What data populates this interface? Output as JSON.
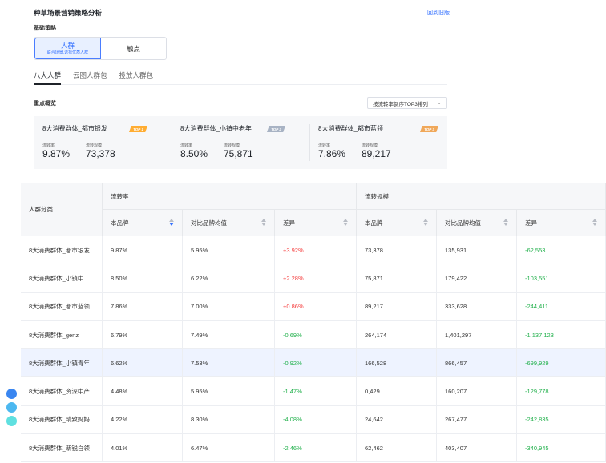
{
  "header": {
    "title": "种草场景营销策略分析",
    "back_label": "回到旧版"
  },
  "strategy": {
    "label": "基础策略",
    "options": [
      {
        "label": "人群",
        "sub": "联合场景,选择优质人群",
        "active": true
      },
      {
        "label": "触点",
        "active": false
      }
    ]
  },
  "tabs": [
    {
      "label": "八大人群",
      "active": true
    },
    {
      "label": "云图人群包",
      "active": false
    },
    {
      "label": "投放人群包",
      "active": false
    }
  ],
  "overview": {
    "label": "重点概览",
    "sort_label": "按流转率倒序TOP3排列",
    "cards": [
      {
        "name": "8大消费群体_都市银发",
        "badge": "TOP 1",
        "badge_color": "#ffad33",
        "rate_label": "流转率",
        "rate": "9.87%",
        "scale_label": "流转规模",
        "scale": "73,378"
      },
      {
        "name": "8大消费群体_小镇中老年",
        "badge": "TOP 2",
        "badge_color": "#a8b3c4",
        "rate_label": "流转率",
        "rate": "8.50%",
        "scale_label": "流转规模",
        "scale": "75,871"
      },
      {
        "name": "8大消费群体_都市蓝领",
        "badge": "TOP 3",
        "badge_color": "#f0a85a",
        "rate_label": "流转率",
        "rate": "7.86%",
        "scale_label": "流转规模",
        "scale": "89,217"
      }
    ]
  },
  "table": {
    "corner": "人群分类",
    "groups": [
      "流转率",
      "流转规模"
    ],
    "columns": [
      "本品牌",
      "对比品牌均值",
      "差异",
      "本品牌",
      "对比品牌均值",
      "差异"
    ],
    "rows": [
      [
        "8大消费群体_都市银发",
        "9.87%",
        "5.95%",
        "+3.92%",
        "73,378",
        "135,931",
        "-62,553"
      ],
      [
        "8大消费群体_小镇中...",
        "8.50%",
        "6.22%",
        "+2.28%",
        "75,871",
        "179,422",
        "-103,551"
      ],
      [
        "8大消费群体_都市蓝领",
        "7.86%",
        "7.00%",
        "+0.86%",
        "89,217",
        "333,628",
        "-244,411"
      ],
      [
        "8大消费群体_genz",
        "6.79%",
        "7.49%",
        "-0.69%",
        "264,174",
        "1,401,297",
        "-1,137,123"
      ],
      [
        "8大消费群体_小镇青年",
        "6.62%",
        "7.53%",
        "-0.92%",
        "166,528",
        "866,457",
        "-699,929"
      ],
      [
        "8大消费群体_资深中产",
        "4.48%",
        "5.95%",
        "-1.47%",
        "0,429",
        "160,207",
        "-129,778"
      ],
      [
        "8大消费群体_精致妈妈",
        "4.22%",
        "8.30%",
        "-4.08%",
        "24,642",
        "267,477",
        "-242,835"
      ],
      [
        "8大消费群体_新锐白领",
        "4.01%",
        "6.47%",
        "-2.46%",
        "62,462",
        "403,407",
        "-340,945"
      ]
    ],
    "highlight_row": 4
  },
  "floating_dots": [
    "#3a86f0",
    "#4cb8f0",
    "#5fe0e0"
  ]
}
